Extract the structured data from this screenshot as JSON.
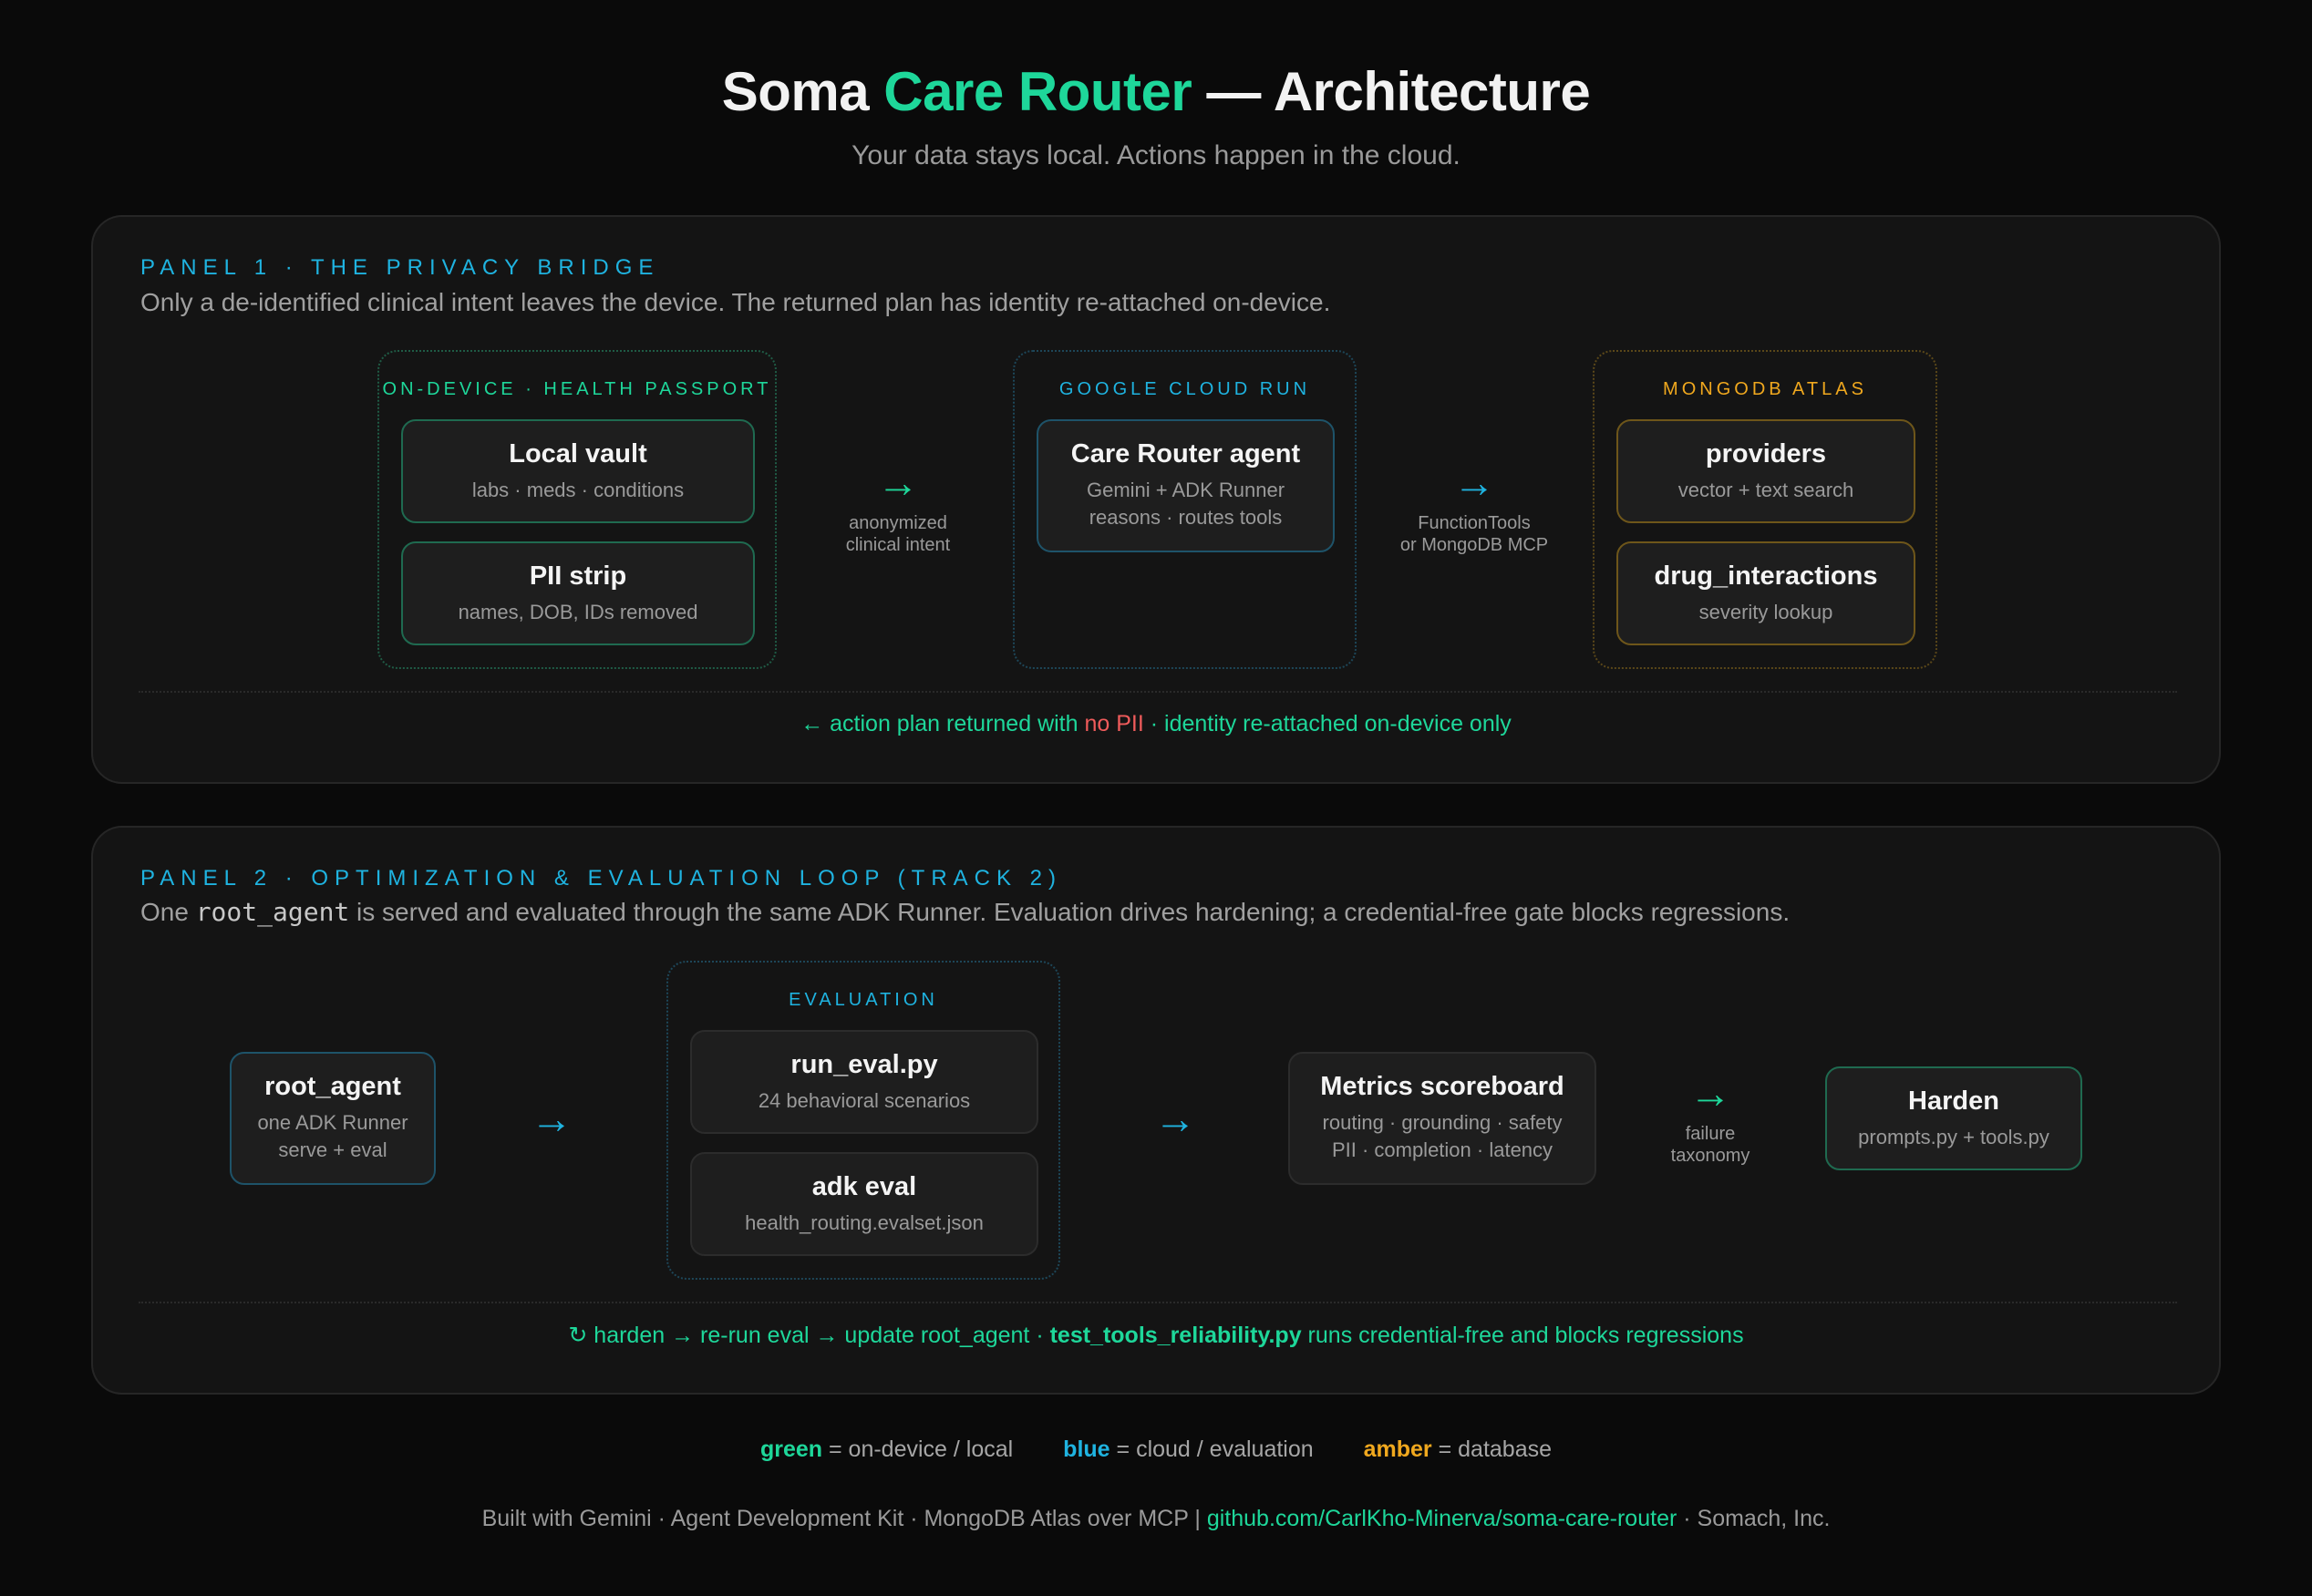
{
  "header": {
    "title_pre": "Soma ",
    "title_accent": "Care Router",
    "title_post": " — Architecture",
    "subtitle": "Your data stays local. Actions happen in the cloud."
  },
  "panel1": {
    "label": "PANEL 1 · THE PRIVACY BRIDGE",
    "description": "Only a de-identified clinical intent leaves the device. The returned plan has identity re-attached on-device.",
    "groups": {
      "device": {
        "label": "ON-DEVICE · HEALTH PASSPORT",
        "cards": [
          {
            "title": "Local vault",
            "sub": "labs · meds · conditions"
          },
          {
            "title": "PII strip",
            "sub": "names, DOB, IDs removed"
          }
        ]
      },
      "cloud": {
        "label": "GOOGLE CLOUD RUN",
        "cards": [
          {
            "title": "Care Router agent",
            "sub1": "Gemini + ADK Runner",
            "sub2": "reasons · routes tools"
          }
        ]
      },
      "db": {
        "label": "MONGODB ATLAS",
        "cards": [
          {
            "title": "providers",
            "sub": "vector + text search"
          },
          {
            "title": "drug_interactions",
            "sub": "severity lookup"
          }
        ]
      }
    },
    "arrows": [
      {
        "glyph": "→",
        "caption1": "anonymized",
        "caption2": "clinical intent"
      },
      {
        "glyph": "→",
        "caption1": "FunctionTools",
        "caption2": "or MongoDB MCP"
      }
    ],
    "footnote": {
      "part1": "← action plan returned with ",
      "part2": "no PII",
      "part3": " · identity re-attached on-device only"
    }
  },
  "panel2": {
    "label": "PANEL 2 · OPTIMIZATION & EVALUATION LOOP (TRACK 2)",
    "description_pre": "One ",
    "description_code": "root_agent",
    "description_post": " is served and evaluated through the same ADK Runner. Evaluation drives hardening; a credential-free gate blocks regressions.",
    "root_agent": {
      "title": "root_agent",
      "sub1": "one ADK Runner",
      "sub2": "serve + eval"
    },
    "evaluation": {
      "label": "EVALUATION",
      "cards": [
        {
          "title": "run_eval.py",
          "sub": "24 behavioral scenarios"
        },
        {
          "title": "adk eval",
          "sub": "health_routing.evalset.json"
        }
      ]
    },
    "metrics": {
      "title": "Metrics scoreboard",
      "sub1": "routing · grounding · safety",
      "sub2": "PII · completion · latency"
    },
    "harden": {
      "title": "Harden",
      "sub": "prompts.py + tools.py"
    },
    "arrows": [
      {
        "glyph": "→"
      },
      {
        "glyph": "→"
      },
      {
        "glyph": "→",
        "caption1": "failure",
        "caption2": "taxonomy"
      }
    ],
    "footnote": {
      "part1": "↻ harden → re-run eval → update root_agent  ·  ",
      "part2": "test_tools_reliability.py",
      "part3": " runs credential-free and blocks regressions"
    }
  },
  "legend": [
    {
      "key": "green",
      "text": " = on-device / local"
    },
    {
      "key": "blue",
      "text": " = cloud / evaluation"
    },
    {
      "key": "amber",
      "text": " = database"
    }
  ],
  "footer": {
    "text": "Built with Gemini · Agent Development Kit · MongoDB Atlas over MCP  |  ",
    "link": "github.com/CarlKho-Minerva/soma-care-router",
    "suffix": " · Somach, Inc."
  },
  "colors": {
    "green": "#1ed79a",
    "blue": "#1fb3e0",
    "amber": "#f0a81e",
    "red": "#ef5b5b",
    "background": "#0a0a0a"
  }
}
